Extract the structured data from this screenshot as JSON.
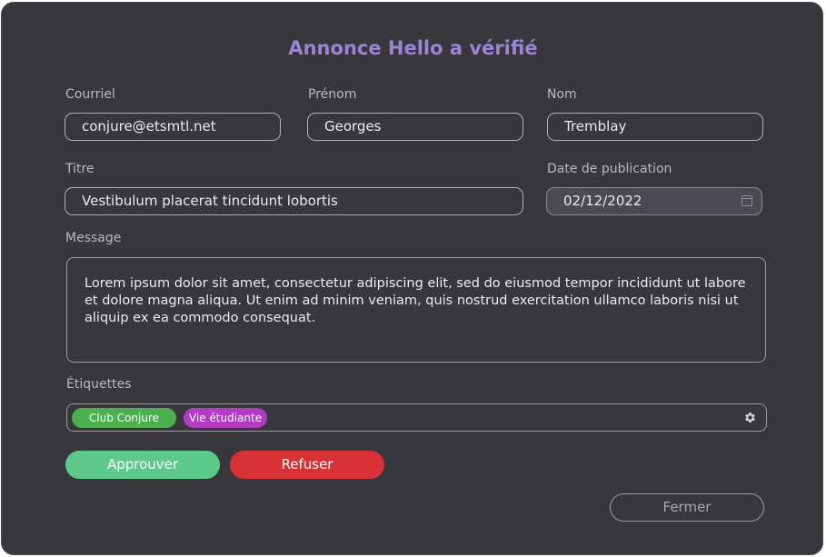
{
  "modal": {
    "title": "Annonce Hello a vérifié"
  },
  "form": {
    "email": {
      "label": "Courriel",
      "value": "conjure@etsmtl.net"
    },
    "first_name": {
      "label": "Prénom",
      "value": "Georges"
    },
    "last_name": {
      "label": "Nom",
      "value": "Tremblay"
    },
    "title": {
      "label": "Titre",
      "value": "Vestibulum placerat tincidunt lobortis"
    },
    "publish_date": {
      "label": "Date de publication",
      "value": "02/12/2022"
    },
    "message": {
      "label": "Message",
      "value": "Lorem ipsum dolor sit amet, consectetur adipiscing elit, sed do eiusmod tempor incididunt ut labore et dolore magna aliqua. Ut enim ad minim veniam, quis nostrud exercitation ullamco laboris nisi ut aliquip ex ea commodo consequat."
    },
    "tags": {
      "label": "Étiquettes",
      "items": [
        {
          "label": "Club Conjure",
          "color": "#4caf50"
        },
        {
          "label": "Vie étudiante",
          "color": "#b43cc4"
        }
      ],
      "settings_icon": "gear-icon"
    }
  },
  "actions": {
    "approve_label": "Approuver",
    "refuse_label": "Refuser",
    "close_label": "Fermer"
  },
  "colors": {
    "background": "#37373c",
    "title": "#9b84d8",
    "approve": "#5dc98a",
    "refuse": "#d83236"
  },
  "icons": {
    "date_picker": "calendar-icon"
  }
}
